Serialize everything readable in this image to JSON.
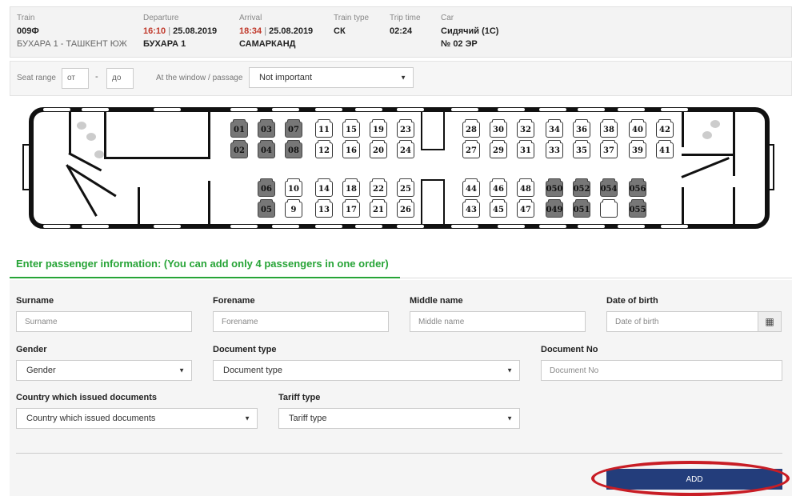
{
  "train_info": {
    "train": {
      "label": "Train",
      "number": "009Ф",
      "route": "БУХАРА 1 - ТАШКЕНТ ЮЖ"
    },
    "departure": {
      "label": "Departure",
      "time": "16:10",
      "date": "25.08.2019",
      "station": "БУХАРА 1"
    },
    "arrival": {
      "label": "Arrival",
      "time": "18:34",
      "date": "25.08.2019",
      "station": "САМАРКАНД"
    },
    "train_type": {
      "label": "Train type",
      "value": "СК"
    },
    "trip_time": {
      "label": "Trip time",
      "value": "02:24"
    },
    "car": {
      "label": "Car",
      "type": "Сидячий (1С)",
      "number": "№ 02 ЭР"
    }
  },
  "filters": {
    "seat_range_label": "Seat range",
    "from_placeholder": "от",
    "dash": "-",
    "to_placeholder": "до",
    "window_label": "At the window / passage",
    "window_value": "Not important"
  },
  "seat_map": {
    "seats": [
      {
        "n": "01",
        "taken": true
      },
      {
        "n": "02",
        "taken": true
      },
      {
        "n": "03",
        "taken": true
      },
      {
        "n": "04",
        "taken": true
      },
      {
        "n": "07",
        "taken": true
      },
      {
        "n": "08",
        "taken": true
      },
      {
        "n": "11",
        "taken": false
      },
      {
        "n": "12",
        "taken": false
      },
      {
        "n": "15",
        "taken": false
      },
      {
        "n": "16",
        "taken": false
      },
      {
        "n": "19",
        "taken": false
      },
      {
        "n": "20",
        "taken": false
      },
      {
        "n": "23",
        "taken": false
      },
      {
        "n": "24",
        "taken": false
      },
      {
        "n": "28",
        "taken": false
      },
      {
        "n": "27",
        "taken": false
      },
      {
        "n": "30",
        "taken": false
      },
      {
        "n": "29",
        "taken": false
      },
      {
        "n": "32",
        "taken": false
      },
      {
        "n": "31",
        "taken": false
      },
      {
        "n": "34",
        "taken": false
      },
      {
        "n": "33",
        "taken": false
      },
      {
        "n": "36",
        "taken": false
      },
      {
        "n": "35",
        "taken": false
      },
      {
        "n": "38",
        "taken": false
      },
      {
        "n": "37",
        "taken": false
      },
      {
        "n": "40",
        "taken": false
      },
      {
        "n": "39",
        "taken": false
      },
      {
        "n": "42",
        "taken": false
      },
      {
        "n": "41",
        "taken": false
      },
      {
        "n": "06",
        "taken": true
      },
      {
        "n": "05",
        "taken": true
      },
      {
        "n": "10",
        "taken": false
      },
      {
        "n": "9",
        "taken": false
      },
      {
        "n": "14",
        "taken": false
      },
      {
        "n": "13",
        "taken": false
      },
      {
        "n": "18",
        "taken": false
      },
      {
        "n": "17",
        "taken": false
      },
      {
        "n": "22",
        "taken": false
      },
      {
        "n": "21",
        "taken": false
      },
      {
        "n": "25",
        "taken": false
      },
      {
        "n": "26",
        "taken": false
      },
      {
        "n": "44",
        "taken": false
      },
      {
        "n": "43",
        "taken": false
      },
      {
        "n": "46",
        "taken": false
      },
      {
        "n": "45",
        "taken": false
      },
      {
        "n": "48",
        "taken": false
      },
      {
        "n": "47",
        "taken": false
      },
      {
        "n": "050",
        "taken": true
      },
      {
        "n": "049",
        "taken": true
      },
      {
        "n": "052",
        "taken": true
      },
      {
        "n": "051",
        "taken": true
      },
      {
        "n": "054",
        "taken": true
      },
      {
        "n": "",
        "taken": false
      },
      {
        "n": "056",
        "taken": true
      },
      {
        "n": "055",
        "taken": true
      }
    ]
  },
  "passenger_section": {
    "title": "Enter passenger information: (You can add only 4 passengers in one order)"
  },
  "form": {
    "surname": {
      "label": "Surname",
      "placeholder": "Surname"
    },
    "forename": {
      "label": "Forename",
      "placeholder": "Forename"
    },
    "middle_name": {
      "label": "Middle name",
      "placeholder": "Middle name"
    },
    "dob": {
      "label": "Date of birth",
      "placeholder": "Date of birth"
    },
    "gender": {
      "label": "Gender",
      "value": "Gender"
    },
    "doc_type": {
      "label": "Document type",
      "value": "Document type"
    },
    "doc_no": {
      "label": "Document No",
      "placeholder": "Document No"
    },
    "country": {
      "label": "Country which issued documents",
      "value": "Country which issued documents"
    },
    "tariff": {
      "label": "Tariff type",
      "value": "Tariff type"
    }
  },
  "add_button": {
    "label": "ADD"
  },
  "colors": {
    "accent_green": "#27a437",
    "button_blue": "#233d7b",
    "highlight_red": "#c81d25",
    "taken_seat": "#777777"
  }
}
